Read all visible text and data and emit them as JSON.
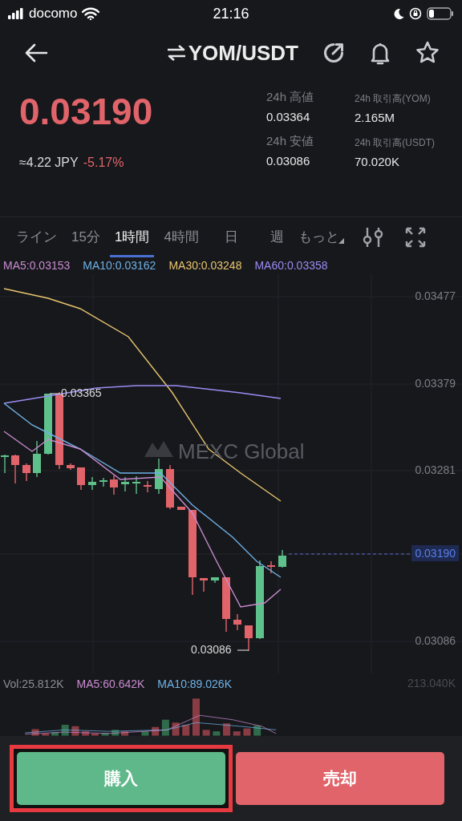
{
  "status_bar": {
    "carrier": "docomo",
    "time": "21:16"
  },
  "header": {
    "title": "YOM/USDT"
  },
  "ticker": {
    "last_price": "0.03190",
    "fiat_value": "≈4.22 JPY",
    "change": "-5.17%"
  },
  "stats": [
    {
      "label": "24h 高値",
      "value": "0.03364"
    },
    {
      "label": "24h 取引高(YOM)",
      "value": "2.165M"
    },
    {
      "label": "24h 安値",
      "value": "0.03086"
    },
    {
      "label": "24h 取引高(USDT)",
      "value": "70.020K"
    }
  ],
  "timeframe_tabs": [
    {
      "label": "ライン",
      "selected": false
    },
    {
      "label": "15分",
      "selected": false
    },
    {
      "label": "1時間",
      "selected": true
    },
    {
      "label": "4時間",
      "selected": false
    },
    {
      "label": "日",
      "selected": false
    },
    {
      "label": "週",
      "selected": false
    },
    {
      "label": "もっと",
      "selected": false,
      "dropdown": true
    }
  ],
  "ma_legend": [
    {
      "label": "MA5:0.03153",
      "color": "#c98bd0"
    },
    {
      "label": "MA10:0.03162",
      "color": "#6fb2e6"
    },
    {
      "label": "MA30:0.03248",
      "color": "#e8c56e"
    },
    {
      "label": "MA60:0.03358",
      "color": "#9a8cf2"
    }
  ],
  "chart": {
    "watermark": "MEXC Global",
    "price_axis": [
      "0.03477",
      "0.03379",
      "0.03281",
      "0.03086"
    ],
    "current_price": "0.03190",
    "high_marker": "0.03365",
    "low_marker": "0.03086"
  },
  "volume": {
    "legend": [
      {
        "label": "Vol:25.812K",
        "color": "#8c8d93"
      },
      {
        "label": "MA5:60.642K",
        "color": "#c98bd0"
      },
      {
        "label": "MA10:89.026K",
        "color": "#6fb2e6"
      }
    ],
    "axis_max": "213.040K"
  },
  "actions": [
    {
      "label": "購入",
      "kind": "buy",
      "highlighted": true
    },
    {
      "label": "売却",
      "kind": "sell",
      "highlighted": false
    }
  ]
}
